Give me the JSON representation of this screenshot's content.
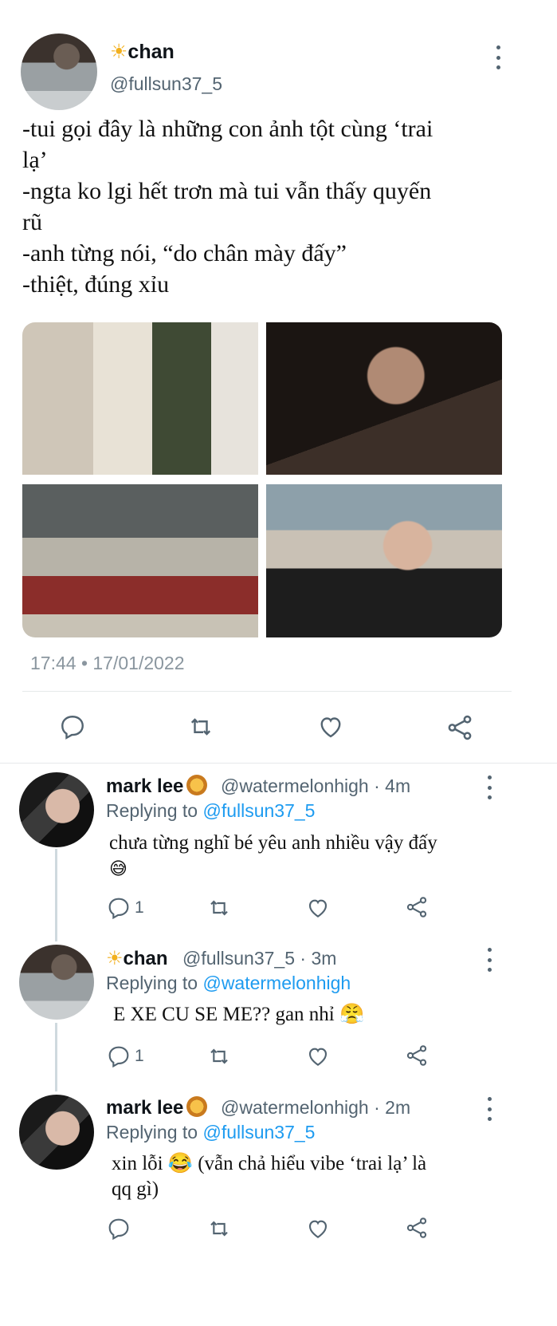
{
  "tweet": {
    "author_name": "chan",
    "author_handle": "@fullsun37_5",
    "name_prefix_emoji": "☀",
    "lines": [
      "-tui gọi đây là những con ảnh tột cùng ‘trai",
      "lạ’",
      "-ngta ko lgi hết trơn mà tui vẫn thấy quyến",
      "rũ",
      "-anh từng nói, “do chân mày đấy”",
      "-thiệt, đúng xỉu"
    ],
    "timestamp": "17:44 • 17/01/2022"
  },
  "replies": [
    {
      "name": "mark lee",
      "handle_meta": "@watermelonhigh · 4m",
      "replying_label": "Replying to ",
      "replying_handle": "@fullsun37_5",
      "text_lines": [
        "chưa từng nghĩ bé yêu anh nhiều vậy đấy",
        "😅"
      ],
      "reply_count": "1"
    },
    {
      "name": "chan",
      "handle_meta": "@fullsun37_5 · 3m",
      "replying_label": "Replying to ",
      "replying_handle": "@watermelonhigh",
      "text_lines": [
        "E XE CU SE ME?? gan nhỉ 😤"
      ],
      "reply_count": "1"
    },
    {
      "name": "mark lee",
      "handle_meta": "@watermelonhigh · 2m",
      "replying_label": "Replying to ",
      "replying_handle": "@fullsun37_5",
      "text_lines": [
        "xin lỗi 😂 (vẫn chả hiểu vibe ‘trai lạ’ là",
        "qq gì)"
      ],
      "reply_count": ""
    }
  ],
  "icons": {
    "reply": "reply-icon",
    "retweet": "retweet-icon",
    "like": "like-icon",
    "share": "share-icon",
    "more": "more-icon"
  },
  "colors": {
    "link": "#1d9bf0",
    "secondary_text": "#536471",
    "icon": "#536471"
  }
}
